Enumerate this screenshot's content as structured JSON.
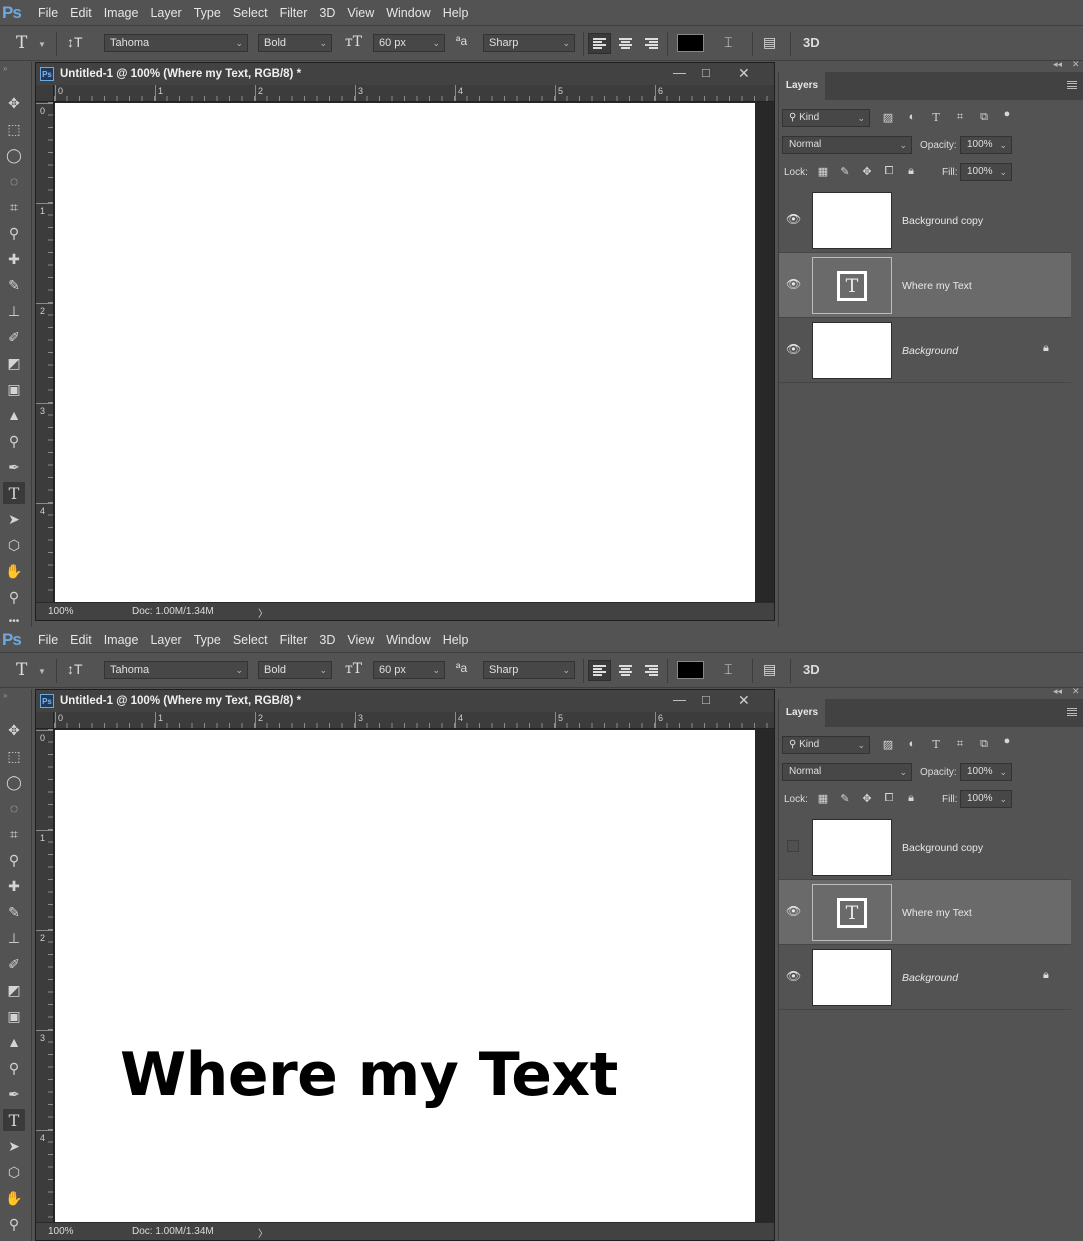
{
  "menu": [
    "File",
    "Edit",
    "Image",
    "Layer",
    "Type",
    "Select",
    "Filter",
    "3D",
    "View",
    "Window",
    "Help"
  ],
  "app_logo": "Ps",
  "options": {
    "font_family": "Tahoma",
    "font_style": "Bold",
    "font_size": "60 px",
    "antialias_label": "aa",
    "antialias": "Sharp",
    "threed": "3D",
    "text_color": "#000000"
  },
  "document": {
    "title": "Untitled-1 @ 100% (Where my Text, RGB/8) *",
    "zoom": "100%",
    "doc_info": "Doc: 1.00M/1.34M",
    "ruler_h": [
      "0",
      "1",
      "2",
      "3",
      "4",
      "5",
      "6"
    ],
    "ruler_v": [
      "0",
      "1",
      "2",
      "3",
      "4"
    ]
  },
  "canvas_text": "Where my Text",
  "layers_panel": {
    "tab": "Layers",
    "filter_kind": "Kind",
    "blend_mode": "Normal",
    "opacity_label": "Opacity:",
    "opacity": "100%",
    "lock_label": "Lock:",
    "fill_label": "Fill:",
    "fill": "100%",
    "layers": [
      {
        "name": "Background copy",
        "type": "pixel"
      },
      {
        "name": "Where my Text",
        "type": "text",
        "thumb_glyph": "T"
      },
      {
        "name": "Background",
        "type": "pixel",
        "locked": true
      }
    ]
  },
  "states": [
    {
      "background_copy_visible": true,
      "text_shown": false
    },
    {
      "background_copy_visible": false,
      "text_shown": true
    }
  ]
}
